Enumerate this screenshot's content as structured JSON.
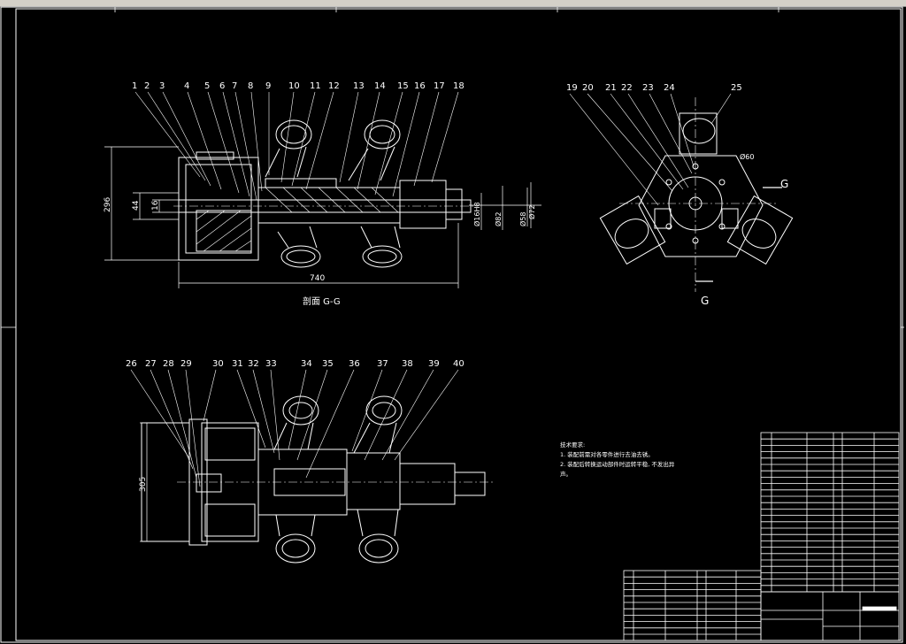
{
  "colors": {
    "background": "#000000",
    "lines": "#ffffff",
    "dims": "#ffffff",
    "accent": "#d4d0c8"
  },
  "view_top": {
    "balloons": [
      "1",
      "2",
      "3",
      "4",
      "5",
      "6",
      "7",
      "8",
      "9",
      "10",
      "11",
      "12",
      "13",
      "14",
      "15",
      "16",
      "17",
      "18"
    ],
    "dim_height": "296",
    "dim_44": "44",
    "dim_16": "16",
    "dim_length": "740",
    "dia_1": "Ø16H8",
    "dia_2": "Ø82",
    "dia_3": "Ø58",
    "dia_4": "Ø72",
    "section_label": "剖面  G-G"
  },
  "view_side": {
    "balloons": [
      "19",
      "20",
      "21",
      "22",
      "23",
      "24",
      "25"
    ],
    "dia": "Ø60",
    "cut_letter_top": "G",
    "cut_letter_bottom": "G"
  },
  "view_bottom": {
    "balloons": [
      "26",
      "27",
      "28",
      "29",
      "30",
      "31",
      "32",
      "33",
      "34",
      "35",
      "36",
      "37",
      "38",
      "39",
      "40"
    ],
    "dim_height": "305"
  },
  "notes": {
    "title": "技术要求:",
    "line1": "1. 装配前需对各零件进行去油去锈。",
    "line2": "2. 装配后转换运动部件时运转平稳, 不发出异",
    "line3": "声。"
  },
  "title_block": {}
}
